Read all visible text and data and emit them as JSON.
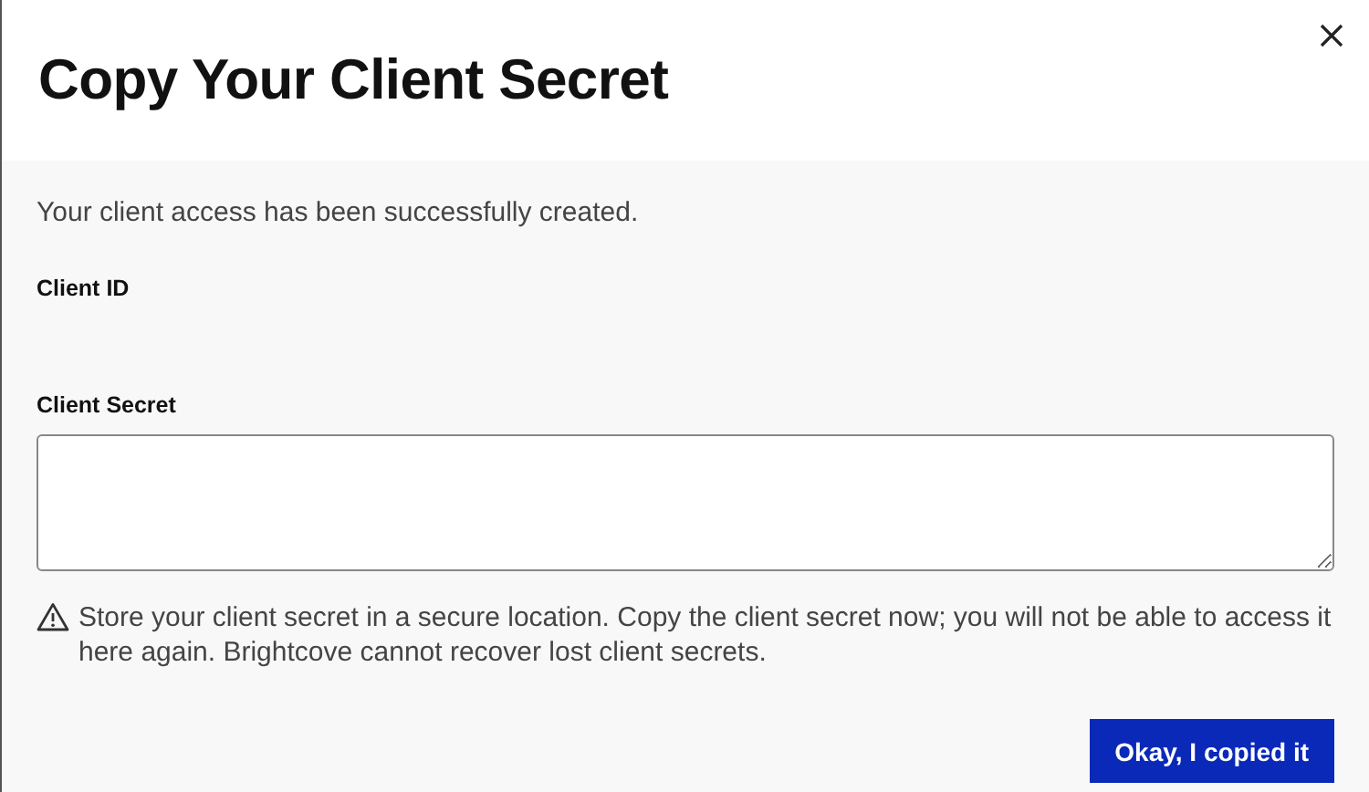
{
  "dialog": {
    "title": "Copy Your Client Secret"
  },
  "message": "Your client access has been successfully created.",
  "fields": [
    {
      "label": "Client ID",
      "kind": "text"
    },
    {
      "label": "Client Secret",
      "kind": "textarea"
    }
  ],
  "warning": "Store your client secret in a secure location. Copy the client secret now; you will not be able to access it here again. Brightcove cannot recover lost client secrets.",
  "buttons": [
    "Okay, I copied it"
  ]
}
